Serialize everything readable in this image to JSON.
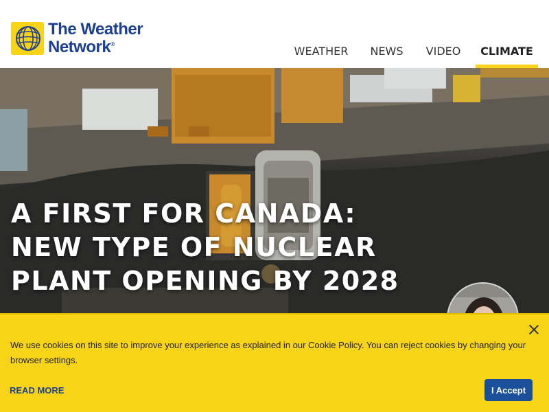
{
  "header": {
    "logo": {
      "line1": "The Weather",
      "line2": "Network",
      "reg": "®"
    },
    "nav": [
      {
        "label": "WEATHER",
        "active": false
      },
      {
        "label": "NEWS",
        "active": false
      },
      {
        "label": "VIDEO",
        "active": false
      },
      {
        "label": "CLIMATE",
        "active": true
      }
    ]
  },
  "hero": {
    "title_lines": [
      "A FIRST FOR CANADA:",
      "NEW TYPE OF NUCLEAR",
      "PLANT OPENING BY 2028"
    ]
  },
  "cookie_banner": {
    "message": "We use cookies on this site to improve your experience as explained in our Cookie Policy. You can reject cookies by changing your browser settings.",
    "read_more": "READ MORE",
    "accept": "I Accept"
  },
  "colors": {
    "brand_blue": "#1c3f94",
    "brand_yellow": "#f7d417",
    "button_blue": "#1a4f99"
  },
  "icons": [
    "weather-network-globe-icon",
    "close-icon"
  ]
}
